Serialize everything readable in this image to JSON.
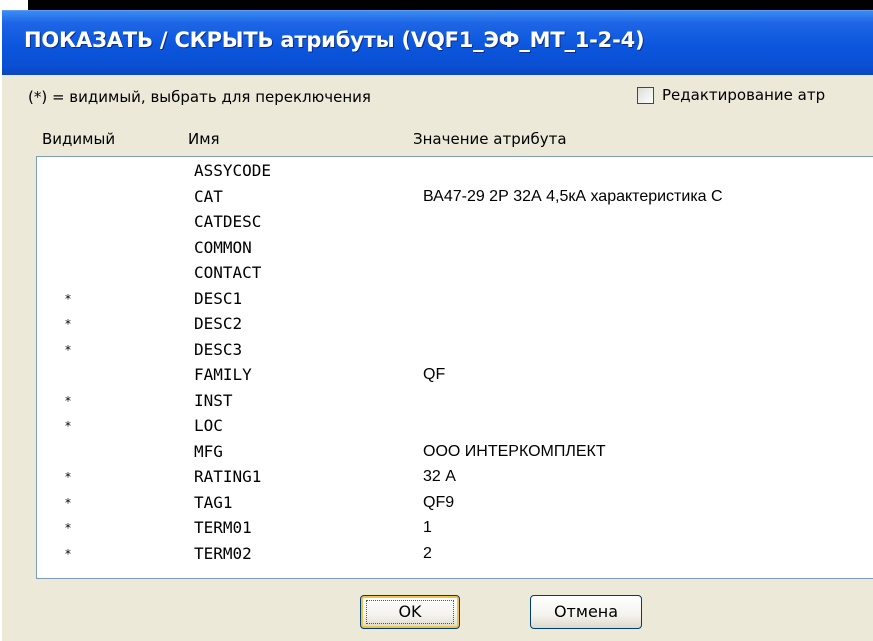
{
  "dialog": {
    "title": "ПОКАЗАТЬ / СКРЫТЬ атрибуты (VQF1_ЭФ_МТ_1-2-4)",
    "hint": "(*) = видимый, выбрать для переключения",
    "edit_checkbox_label": "Редактирование атр",
    "edit_checkbox_checked": false,
    "columns": {
      "visible": "Видимый",
      "name": "Имя",
      "value": "Значение атрибута"
    },
    "rows": [
      {
        "visible": "",
        "name": "ASSYCODE",
        "value": ""
      },
      {
        "visible": "",
        "name": "CAT",
        "value": "ВА47-29 2Р 32А 4,5кА характеристика С"
      },
      {
        "visible": "",
        "name": "CATDESC",
        "value": ""
      },
      {
        "visible": "",
        "name": "COMMON",
        "value": ""
      },
      {
        "visible": "",
        "name": "CONTACT",
        "value": ""
      },
      {
        "visible": "*",
        "name": "DESC1",
        "value": ""
      },
      {
        "visible": "*",
        "name": "DESC2",
        "value": ""
      },
      {
        "visible": "*",
        "name": "DESC3",
        "value": ""
      },
      {
        "visible": "",
        "name": "FAMILY",
        "value": "QF"
      },
      {
        "visible": "*",
        "name": "INST",
        "value": ""
      },
      {
        "visible": "*",
        "name": "LOC",
        "value": ""
      },
      {
        "visible": "",
        "name": "MFG",
        "value": "ООО ИНТЕРКОМПЛЕКТ"
      },
      {
        "visible": "*",
        "name": "RATING1",
        "value": "32 А"
      },
      {
        "visible": "*",
        "name": "TAG1",
        "value": "QF9"
      },
      {
        "visible": "*",
        "name": "TERM01",
        "value": "1"
      },
      {
        "visible": "*",
        "name": "TERM02",
        "value": "2"
      }
    ],
    "buttons": {
      "ok": "OK",
      "cancel": "Отмена"
    }
  }
}
